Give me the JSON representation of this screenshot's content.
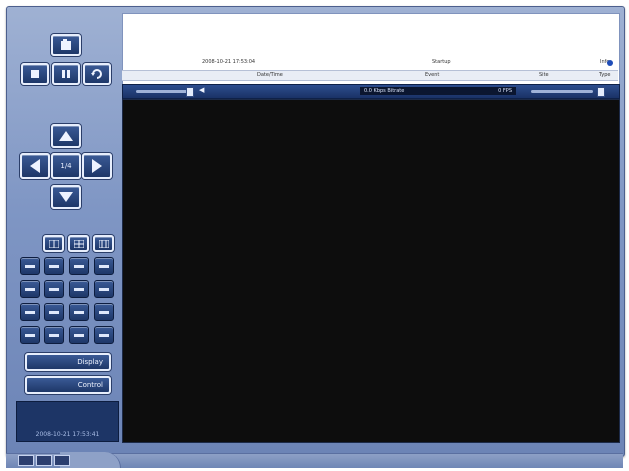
{
  "window": {
    "clock_text": "2008-10-21 17:53:41"
  },
  "controls": {
    "wide_button_1_label": "Display",
    "wide_button_2_label": "Control",
    "center_button_label": "1/4"
  },
  "event_log": {
    "columns": [
      "Type",
      "Site",
      "Event",
      "Date/Time"
    ],
    "rows": [
      {
        "type": "Info",
        "event": "Startup",
        "datetime": "2008-10-21 17:53:04"
      }
    ]
  },
  "toolbar": {
    "fps_label": "FPS",
    "fps_value": "0",
    "bitrate_label": "Bitrate",
    "bitrate_value": "0.0 Kbps",
    "volume_icon": "speaker-icon"
  },
  "colors": {
    "frame": "#7f96c4",
    "button": "#1e3768",
    "video_bg": "#0d0d0d"
  }
}
